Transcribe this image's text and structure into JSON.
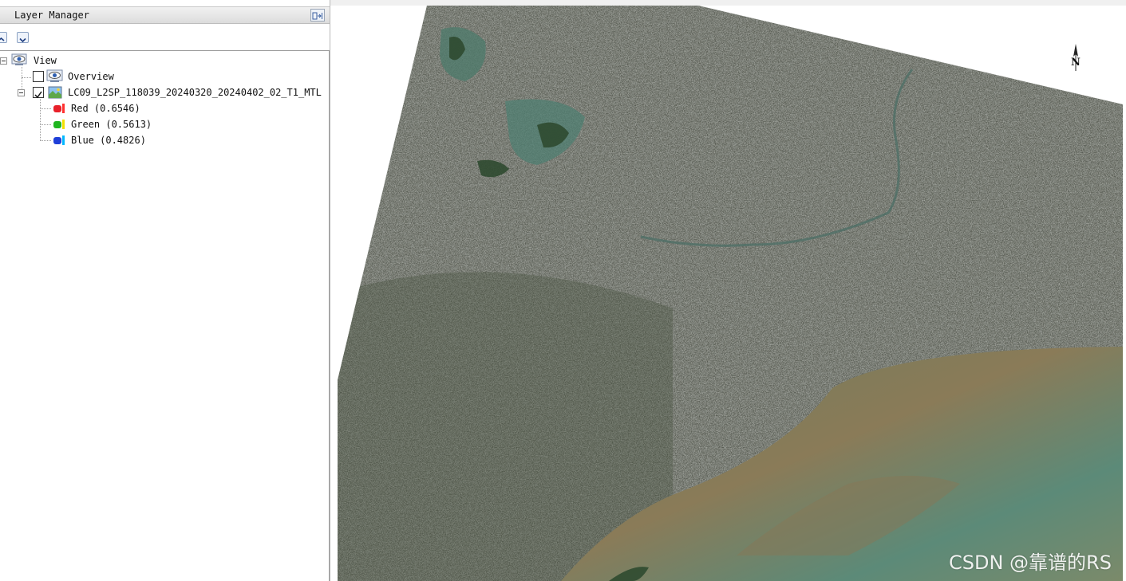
{
  "panel": {
    "title": "Layer Manager"
  },
  "tree": {
    "root_label": "View",
    "overview_label": "Overview",
    "overview_checked": false,
    "layer_label": "LC09_L2SP_118039_20240320_20240402_02_T1_MTL",
    "layer_checked": true,
    "bands": [
      {
        "label": "Red (0.6546)",
        "color": "#e8202a"
      },
      {
        "label": "Green (0.5613)",
        "color": "#1fb51f"
      },
      {
        "label": "Blue (0.4826)",
        "color": "#1f3fd8"
      }
    ]
  },
  "map": {
    "north_label": "N",
    "land_color": "#5a5c52",
    "water_color": "#6e7d5a"
  },
  "watermark": "CSDN @靠谱的RS"
}
